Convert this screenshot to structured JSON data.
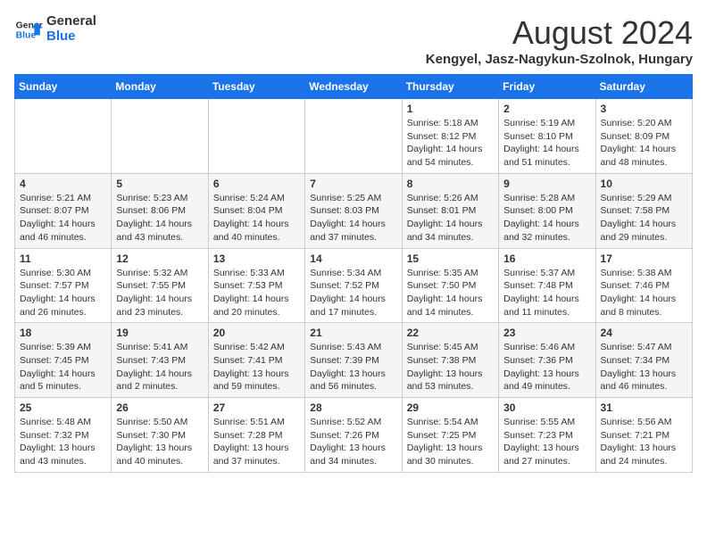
{
  "header": {
    "logo_line1": "General",
    "logo_line2": "Blue",
    "title": "August 2024",
    "subtitle": "Kengyel, Jasz-Nagykun-Szolnok, Hungary"
  },
  "weekdays": [
    "Sunday",
    "Monday",
    "Tuesday",
    "Wednesday",
    "Thursday",
    "Friday",
    "Saturday"
  ],
  "weeks": [
    [
      {
        "day": "",
        "info": ""
      },
      {
        "day": "",
        "info": ""
      },
      {
        "day": "",
        "info": ""
      },
      {
        "day": "",
        "info": ""
      },
      {
        "day": "1",
        "info": "Sunrise: 5:18 AM\nSunset: 8:12 PM\nDaylight: 14 hours\nand 54 minutes."
      },
      {
        "day": "2",
        "info": "Sunrise: 5:19 AM\nSunset: 8:10 PM\nDaylight: 14 hours\nand 51 minutes."
      },
      {
        "day": "3",
        "info": "Sunrise: 5:20 AM\nSunset: 8:09 PM\nDaylight: 14 hours\nand 48 minutes."
      }
    ],
    [
      {
        "day": "4",
        "info": "Sunrise: 5:21 AM\nSunset: 8:07 PM\nDaylight: 14 hours\nand 46 minutes."
      },
      {
        "day": "5",
        "info": "Sunrise: 5:23 AM\nSunset: 8:06 PM\nDaylight: 14 hours\nand 43 minutes."
      },
      {
        "day": "6",
        "info": "Sunrise: 5:24 AM\nSunset: 8:04 PM\nDaylight: 14 hours\nand 40 minutes."
      },
      {
        "day": "7",
        "info": "Sunrise: 5:25 AM\nSunset: 8:03 PM\nDaylight: 14 hours\nand 37 minutes."
      },
      {
        "day": "8",
        "info": "Sunrise: 5:26 AM\nSunset: 8:01 PM\nDaylight: 14 hours\nand 34 minutes."
      },
      {
        "day": "9",
        "info": "Sunrise: 5:28 AM\nSunset: 8:00 PM\nDaylight: 14 hours\nand 32 minutes."
      },
      {
        "day": "10",
        "info": "Sunrise: 5:29 AM\nSunset: 7:58 PM\nDaylight: 14 hours\nand 29 minutes."
      }
    ],
    [
      {
        "day": "11",
        "info": "Sunrise: 5:30 AM\nSunset: 7:57 PM\nDaylight: 14 hours\nand 26 minutes."
      },
      {
        "day": "12",
        "info": "Sunrise: 5:32 AM\nSunset: 7:55 PM\nDaylight: 14 hours\nand 23 minutes."
      },
      {
        "day": "13",
        "info": "Sunrise: 5:33 AM\nSunset: 7:53 PM\nDaylight: 14 hours\nand 20 minutes."
      },
      {
        "day": "14",
        "info": "Sunrise: 5:34 AM\nSunset: 7:52 PM\nDaylight: 14 hours\nand 17 minutes."
      },
      {
        "day": "15",
        "info": "Sunrise: 5:35 AM\nSunset: 7:50 PM\nDaylight: 14 hours\nand 14 minutes."
      },
      {
        "day": "16",
        "info": "Sunrise: 5:37 AM\nSunset: 7:48 PM\nDaylight: 14 hours\nand 11 minutes."
      },
      {
        "day": "17",
        "info": "Sunrise: 5:38 AM\nSunset: 7:46 PM\nDaylight: 14 hours\nand 8 minutes."
      }
    ],
    [
      {
        "day": "18",
        "info": "Sunrise: 5:39 AM\nSunset: 7:45 PM\nDaylight: 14 hours\nand 5 minutes."
      },
      {
        "day": "19",
        "info": "Sunrise: 5:41 AM\nSunset: 7:43 PM\nDaylight: 14 hours\nand 2 minutes."
      },
      {
        "day": "20",
        "info": "Sunrise: 5:42 AM\nSunset: 7:41 PM\nDaylight: 13 hours\nand 59 minutes."
      },
      {
        "day": "21",
        "info": "Sunrise: 5:43 AM\nSunset: 7:39 PM\nDaylight: 13 hours\nand 56 minutes."
      },
      {
        "day": "22",
        "info": "Sunrise: 5:45 AM\nSunset: 7:38 PM\nDaylight: 13 hours\nand 53 minutes."
      },
      {
        "day": "23",
        "info": "Sunrise: 5:46 AM\nSunset: 7:36 PM\nDaylight: 13 hours\nand 49 minutes."
      },
      {
        "day": "24",
        "info": "Sunrise: 5:47 AM\nSunset: 7:34 PM\nDaylight: 13 hours\nand 46 minutes."
      }
    ],
    [
      {
        "day": "25",
        "info": "Sunrise: 5:48 AM\nSunset: 7:32 PM\nDaylight: 13 hours\nand 43 minutes."
      },
      {
        "day": "26",
        "info": "Sunrise: 5:50 AM\nSunset: 7:30 PM\nDaylight: 13 hours\nand 40 minutes."
      },
      {
        "day": "27",
        "info": "Sunrise: 5:51 AM\nSunset: 7:28 PM\nDaylight: 13 hours\nand 37 minutes."
      },
      {
        "day": "28",
        "info": "Sunrise: 5:52 AM\nSunset: 7:26 PM\nDaylight: 13 hours\nand 34 minutes."
      },
      {
        "day": "29",
        "info": "Sunrise: 5:54 AM\nSunset: 7:25 PM\nDaylight: 13 hours\nand 30 minutes."
      },
      {
        "day": "30",
        "info": "Sunrise: 5:55 AM\nSunset: 7:23 PM\nDaylight: 13 hours\nand 27 minutes."
      },
      {
        "day": "31",
        "info": "Sunrise: 5:56 AM\nSunset: 7:21 PM\nDaylight: 13 hours\nand 24 minutes."
      }
    ]
  ]
}
